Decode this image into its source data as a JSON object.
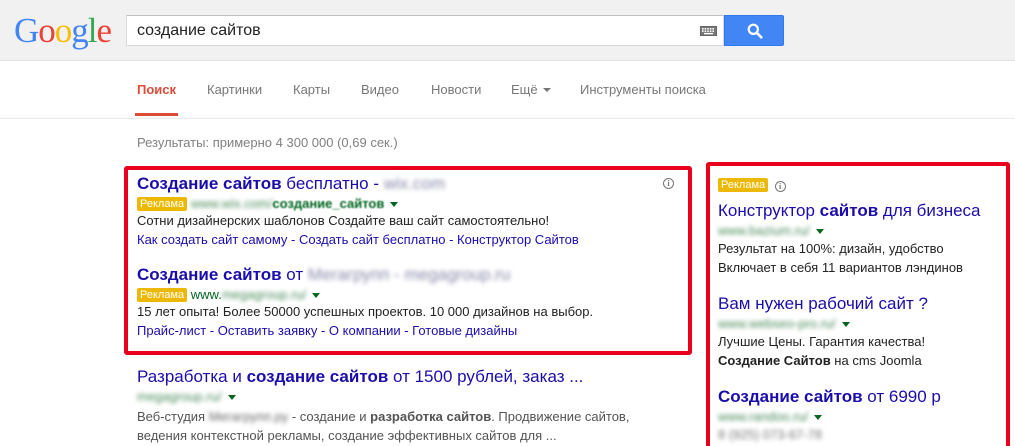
{
  "logo": {
    "letters": [
      "G",
      "o",
      "o",
      "g",
      "l",
      "e"
    ],
    "colors": [
      "#4285f4",
      "#ea4335",
      "#fbbc05",
      "#4285f4",
      "#34a853",
      "#ea4335"
    ]
  },
  "search": {
    "query": "создание сайтов",
    "keyboard_icon": "keyboard-icon",
    "button_icon": "search-icon"
  },
  "tabs": [
    {
      "label": "Поиск",
      "active": true
    },
    {
      "label": "Картинки"
    },
    {
      "label": "Карты"
    },
    {
      "label": "Видео"
    },
    {
      "label": "Новости"
    },
    {
      "label": "Ещё"
    },
    {
      "label": "Инструменты поиска"
    }
  ],
  "stats": "Результаты: примерно 4 300 000 (0,69 сек.)",
  "ad_label": "Реклама",
  "ads": [
    {
      "title_bold": "Создание сайтов",
      "title_rest": " бесплатно - ",
      "title_blur": "wix.com",
      "url_blur": "www.wix.com/",
      "url_bold": "создание_сайтов",
      "lines": [
        "Сотни дизайнерских шаблонов Создайте ваш сайт самостоятельно!"
      ],
      "sitelinks": "Как создать сайт самому - Создать сайт бесплатно - Конструктор Сайтов"
    },
    {
      "title_bold": "Создание сайтов",
      "title_rest": " от ",
      "title_blur": "Мегагрупп - megagroup.ru",
      "url_prefix": "www.",
      "url_blur": "megagroup.ru/",
      "lines": [
        "15 лет опыта! Более 50000 успешных проектов. 10 000 дизайнов на выбор."
      ],
      "sitelinks": "Прайс-лист - Оставить заявку - О компании - Готовые дизайны"
    }
  ],
  "organic": {
    "title_a": "Разработка и ",
    "title_bold": "создание сайтов",
    "title_rest": " от 1500 рублей, заказ ...",
    "url_blur": "megagroup.ru/",
    "line1_a": "Веб-студия ",
    "line1_blur": "Мегагрупп.ру",
    "line1_b": " - создание и ",
    "line1_bold": "разработка сайтов",
    "line1_c": ". Продвижение сайтов,",
    "line2": "ведения контекстной рекламы, создание эффективных сайтов для ..."
  },
  "side_ads": [
    {
      "title_a": "Конструктор ",
      "title_bold": "сайтов",
      "title_rest": " для бизнеса",
      "url_blur": "www.bazium.ru/",
      "lines": [
        "Результат на 100%: дизайн, удобство",
        "Включает в себя 11 вариантов лэндинов"
      ]
    },
    {
      "title": "Вам нужен рабочий сайт ?",
      "url_blur": "www.webseo-pro.ru/",
      "line1": "Лучшие Цены. Гарантия качества!",
      "line2_bold": "Создание Сайтов",
      "line2_rest": " на cms Joomla"
    },
    {
      "title_bold": "Создание сайтов",
      "title_rest": " от 6990 р",
      "url_blur": "www.randoo.ru/",
      "phone_blur": "8 (925) 073-67-78"
    }
  ],
  "colors": {
    "link": "#1a0dab",
    "url": "#006621",
    "ad_badge": "#edb802",
    "highlight_box": "#e8001c",
    "active_tab": "#dd4b39",
    "search_button": "#4285f4"
  }
}
